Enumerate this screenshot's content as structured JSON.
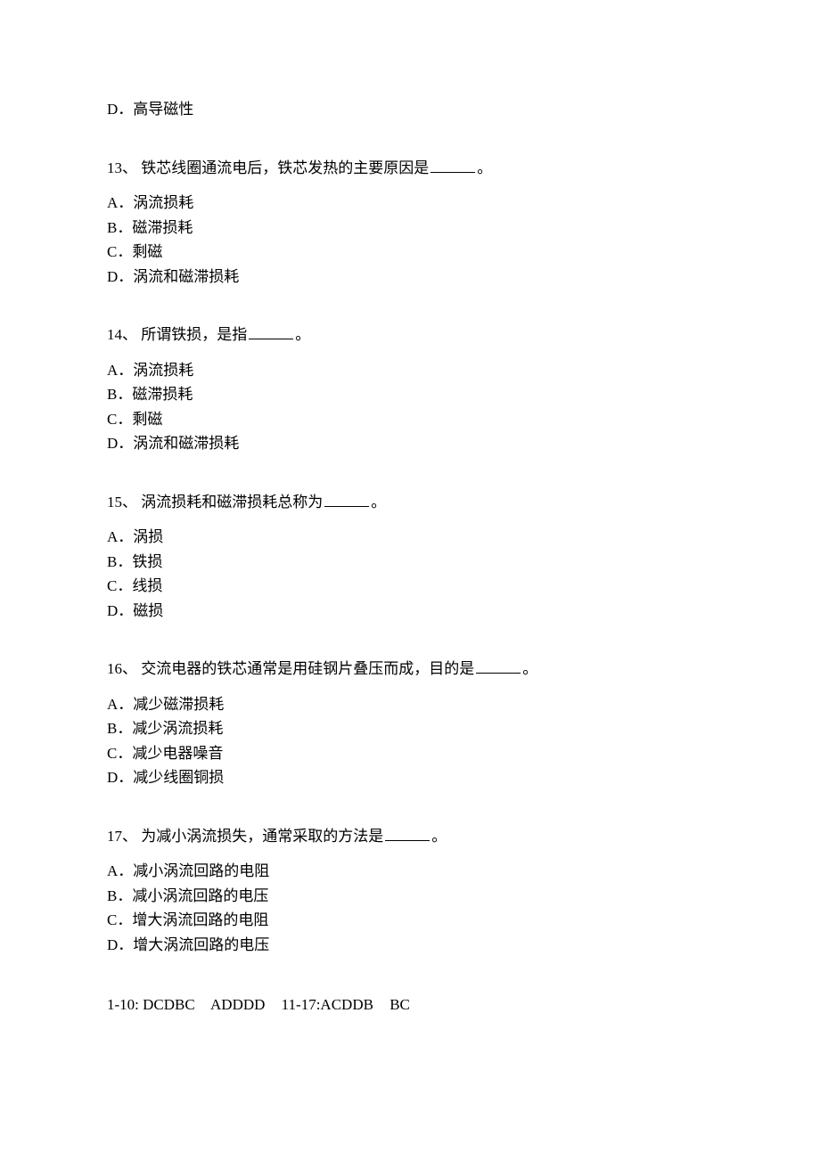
{
  "orphan_option": {
    "label": "D．高导磁性"
  },
  "questions": [
    {
      "num": "13、",
      "stem_before": "铁芯线圈通流电后，铁芯发热的主要原因是",
      "stem_after": "。",
      "options": [
        "A．涡流损耗",
        "B．磁滞损耗",
        "C．剩磁",
        "D．涡流和磁滞损耗"
      ]
    },
    {
      "num": "14、",
      "stem_before": "所谓铁损，是指",
      "stem_after": "。",
      "options": [
        "A．涡流损耗",
        "B．磁滞损耗",
        "C．剩磁",
        "D．涡流和磁滞损耗"
      ]
    },
    {
      "num": "15、",
      "stem_before": "涡流损耗和磁滞损耗总称为",
      "stem_after": "。",
      "options": [
        "A．涡损",
        "B．铁损",
        "C．线损",
        "D．磁损"
      ]
    },
    {
      "num": "16、",
      "stem_before": "交流电器的铁芯通常是用硅钢片叠压而成，目的是",
      "stem_after": "。",
      "options": [
        "A．减少磁滞损耗",
        "B．减少涡流损耗",
        "C．减少电器噪音",
        "D．减少线圈铜损"
      ]
    },
    {
      "num": "17、",
      "stem_before": "为减小涡流损失，通常采取的方法是",
      "stem_after": "。",
      "options": [
        "A．减小涡流回路的电阻",
        "B．减小涡流回路的电压",
        "C．增大涡流回路的电阻",
        "D．增大涡流回路的电压"
      ]
    }
  ],
  "answers_line": {
    "part1": "1-10: DCDBC",
    "part2": "ADDDD",
    "part3": "11-17:ACDDB",
    "part4": "BC"
  }
}
